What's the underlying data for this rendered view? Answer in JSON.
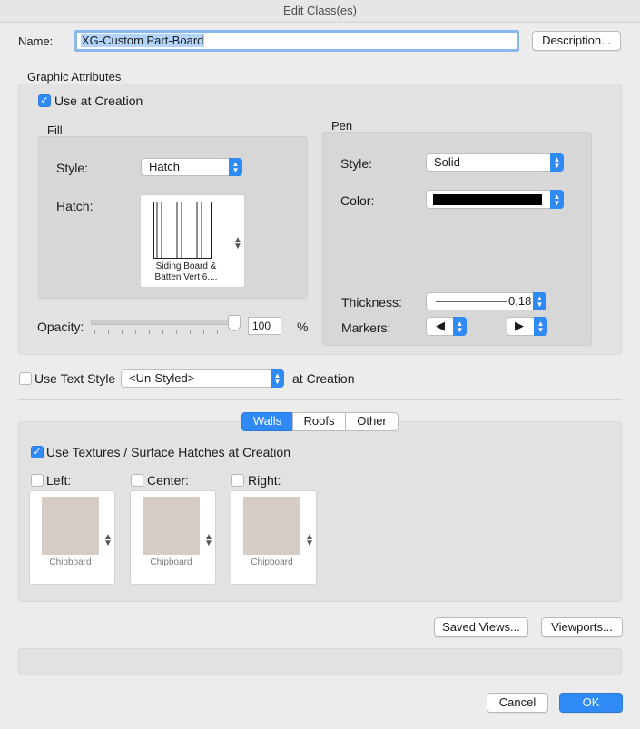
{
  "window": {
    "title": "Edit Class(es)"
  },
  "name": {
    "label": "Name:",
    "value": "XG-Custom Part-Board",
    "description_button": "Description..."
  },
  "graphic": {
    "section_label": "Graphic Attributes",
    "use_at_creation": {
      "label": "Use at Creation",
      "checked": true
    },
    "fill": {
      "label": "Fill",
      "style_label": "Style:",
      "style_value": "Hatch",
      "hatch_label": "Hatch:",
      "hatch_caption_line1": "Siding Board &",
      "hatch_caption_line2": "Batten Vert 6...."
    },
    "opacity": {
      "label": "Opacity:",
      "value": "100",
      "unit": "%",
      "level": 1.0
    },
    "pen": {
      "label": "Pen",
      "style_label": "Style:",
      "style_value": "Solid",
      "color_label": "Color:",
      "color_value": "#000000",
      "thickness_label": "Thickness:",
      "thickness_value": "0,18",
      "markers_label": "Markers:",
      "marker_start": "◀",
      "marker_end": "▶"
    }
  },
  "text_style": {
    "label": "Use Text Style",
    "checked": false,
    "value": "<Un-Styled>",
    "suffix": "at Creation"
  },
  "tabs": [
    {
      "label": "Walls",
      "selected": true
    },
    {
      "label": "Roofs",
      "selected": false
    },
    {
      "label": "Other",
      "selected": false
    }
  ],
  "textures": {
    "use_label": "Use Textures / Surface Hatches at Creation",
    "checked": true,
    "left": {
      "label": "Left:",
      "caption": "Chipboard",
      "checked": false
    },
    "center": {
      "label": "Center:",
      "caption": "Chipboard",
      "checked": false
    },
    "right": {
      "label": "Right:",
      "caption": "Chipboard",
      "checked": false
    }
  },
  "buttons": {
    "saved_views": "Saved Views...",
    "viewports": "Viewports...",
    "cancel": "Cancel",
    "ok": "OK"
  },
  "colors": {
    "accent": "#2f8af5",
    "texture": "#d4ccc5"
  }
}
